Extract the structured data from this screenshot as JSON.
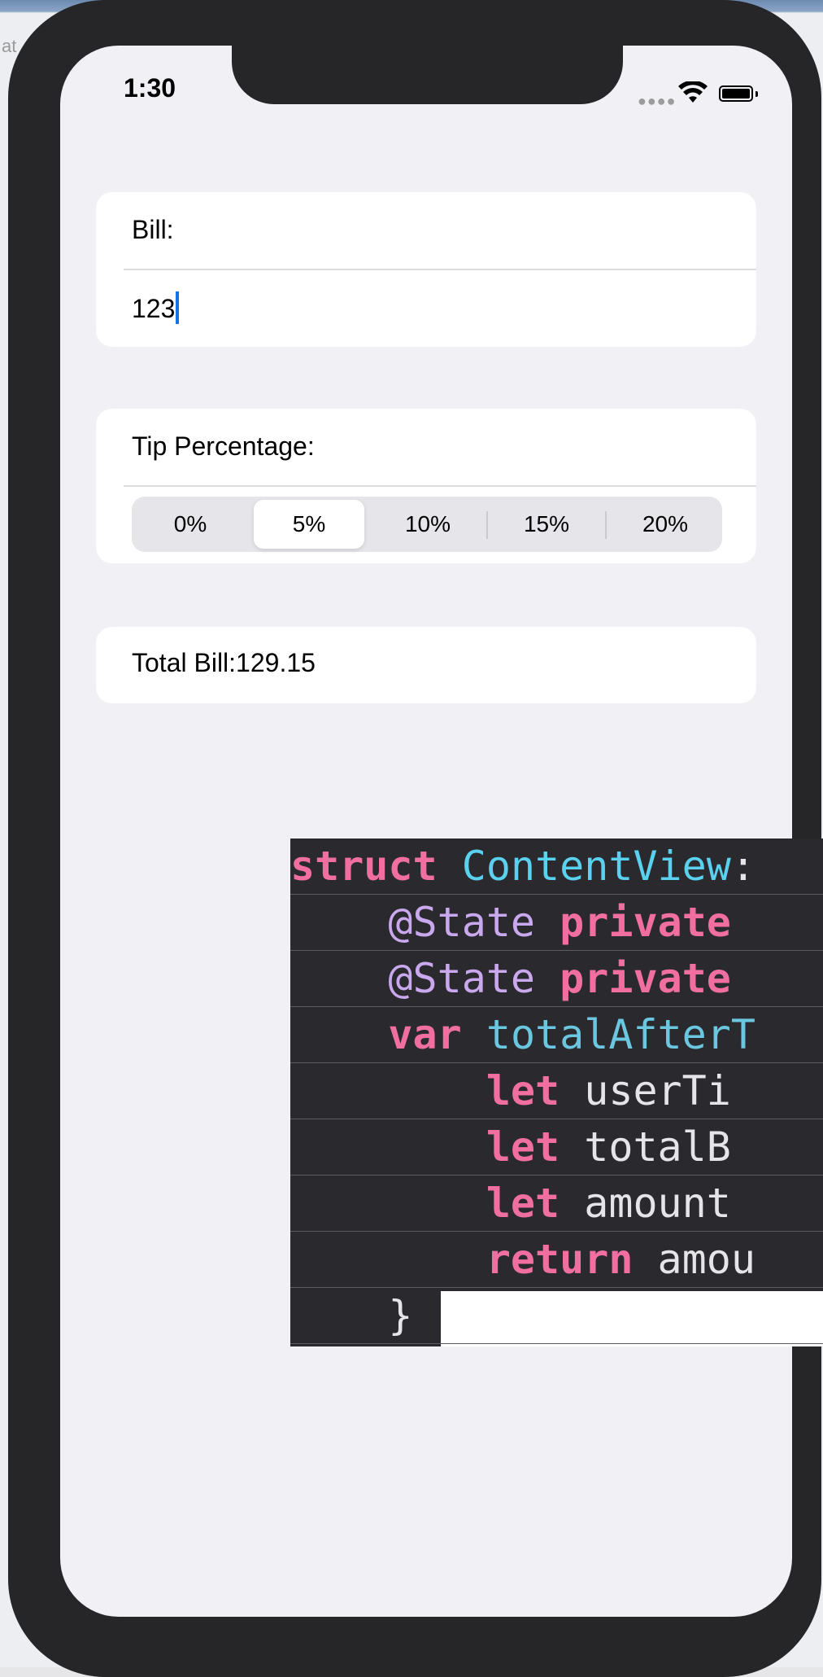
{
  "background_text": "at",
  "status_bar": {
    "time": "1:30"
  },
  "bill_card": {
    "label": "Bill:",
    "value": "123"
  },
  "tip_card": {
    "label": "Tip Percentage:",
    "options": [
      "0%",
      "5%",
      "10%",
      "15%",
      "20%"
    ],
    "selected": "5%"
  },
  "total_card": {
    "text": "Total Bill:129.15"
  },
  "code": {
    "lines": [
      [
        [
          "kw",
          "struct"
        ],
        [
          "plain",
          " "
        ],
        [
          "type",
          "ContentView"
        ],
        [
          "plain",
          ":"
        ]
      ],
      [
        [
          "plain",
          "    "
        ],
        [
          "attr",
          "@State"
        ],
        [
          "plain",
          " "
        ],
        [
          "kw",
          "private"
        ]
      ],
      [
        [
          "plain",
          "    "
        ],
        [
          "attr",
          "@State"
        ],
        [
          "plain",
          " "
        ],
        [
          "kw",
          "private"
        ]
      ],
      [
        [
          "plain",
          "    "
        ],
        [
          "kw",
          "var"
        ],
        [
          "plain",
          " "
        ],
        [
          "ident",
          "totalAfterT"
        ]
      ],
      [
        [
          "plain",
          "        "
        ],
        [
          "kw",
          "let"
        ],
        [
          "plain",
          " userTi"
        ]
      ],
      [
        [
          "plain",
          "        "
        ],
        [
          "kw",
          "let"
        ],
        [
          "plain",
          " totalB"
        ]
      ],
      [
        [
          "plain",
          "        "
        ],
        [
          "kw",
          "let"
        ],
        [
          "plain",
          " amount"
        ]
      ],
      [
        [
          "plain",
          "        "
        ],
        [
          "kw",
          "return"
        ],
        [
          "plain",
          " amou"
        ]
      ],
      [
        [
          "plain",
          "    }"
        ]
      ]
    ]
  },
  "colors": {
    "accent": "#1473e6",
    "keyword": "#f06fa0",
    "type": "#5ad1ef",
    "attribute": "#c9a8ee",
    "code_bg": "#29292e"
  }
}
